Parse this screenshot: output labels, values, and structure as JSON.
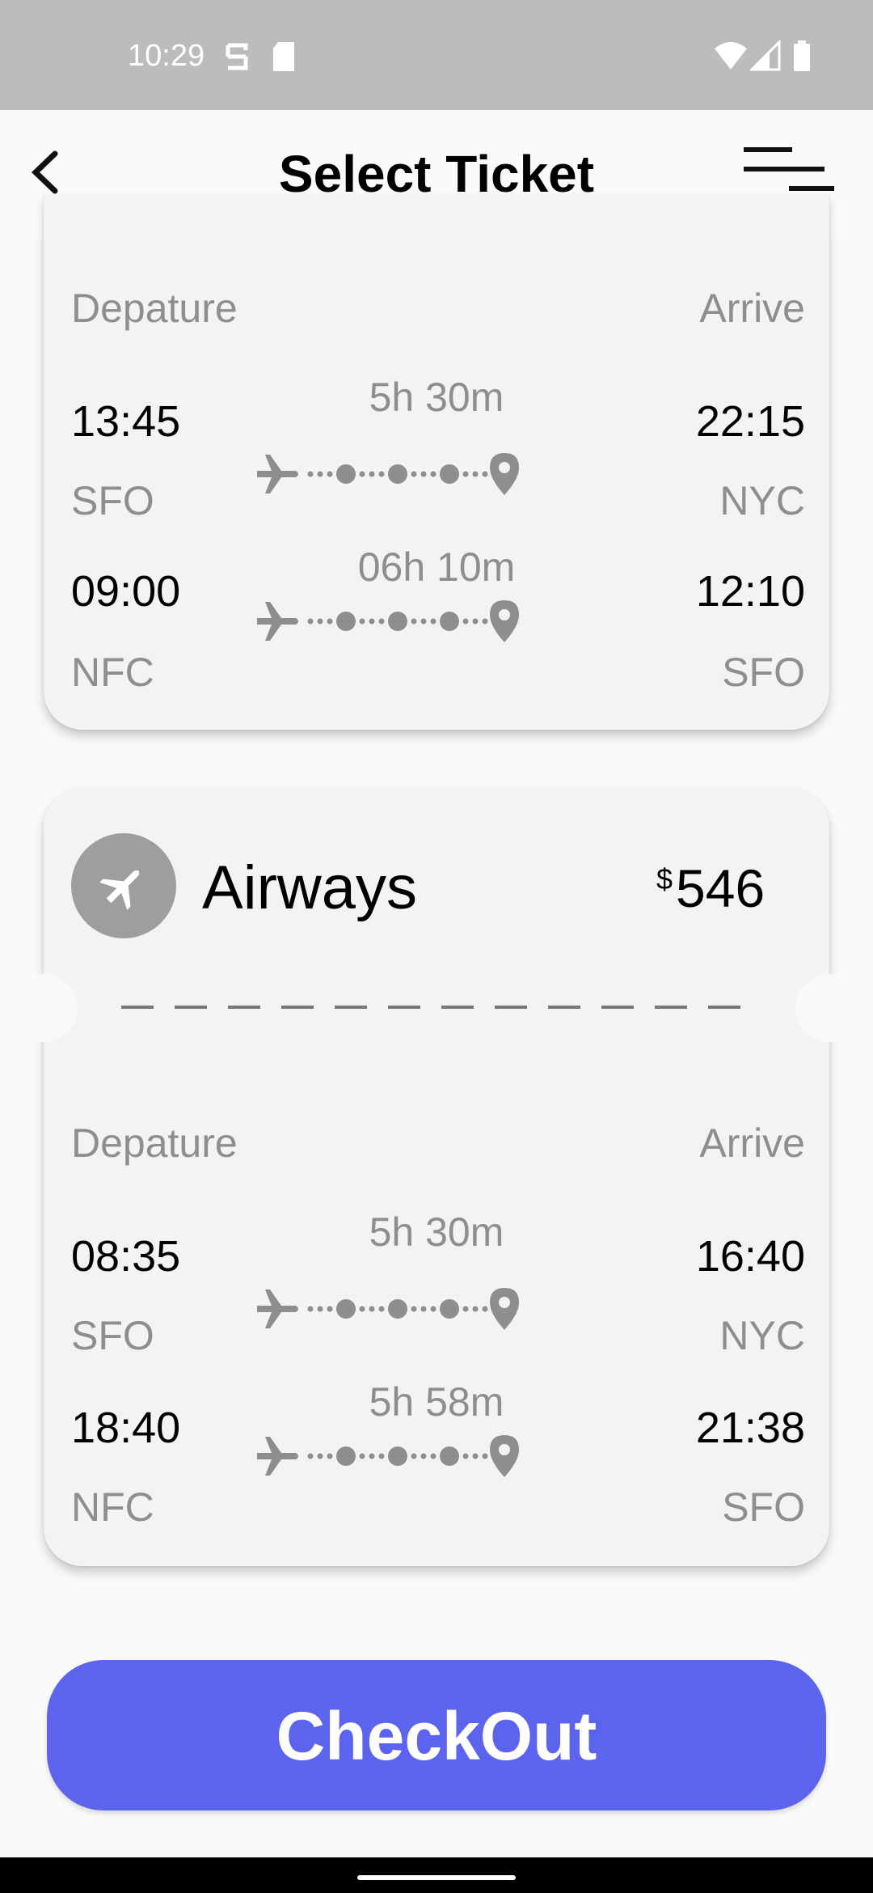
{
  "status_bar": {
    "time": "10:29"
  },
  "header": {
    "title": "Select Ticket"
  },
  "cards": [
    {
      "labels": {
        "departure": "Depature",
        "arrive": "Arrive"
      },
      "flights": [
        {
          "depart_time": "13:45",
          "depart_code": "SFO",
          "duration": "5h 30m",
          "arrive_time": "22:15",
          "arrive_code": "NYC"
        },
        {
          "depart_time": "09:00",
          "depart_code": "NFC",
          "duration": "06h 10m",
          "arrive_time": "12:10",
          "arrive_code": "SFO"
        }
      ]
    },
    {
      "airline": "Airways",
      "currency": "$",
      "price": "546",
      "labels": {
        "departure": "Depature",
        "arrive": "Arrive"
      },
      "flights": [
        {
          "depart_time": "08:35",
          "depart_code": "SFO",
          "duration": "5h 30m",
          "arrive_time": "16:40",
          "arrive_code": "NYC"
        },
        {
          "depart_time": "18:40",
          "depart_code": "NFC",
          "duration": "5h 58m",
          "arrive_time": "21:38",
          "arrive_code": "SFO"
        }
      ]
    }
  ],
  "checkout": {
    "label": "CheckOut"
  },
  "colors": {
    "accent": "#5c63ec",
    "muted": "#8e8e8e",
    "card": "#f3f3f3"
  }
}
